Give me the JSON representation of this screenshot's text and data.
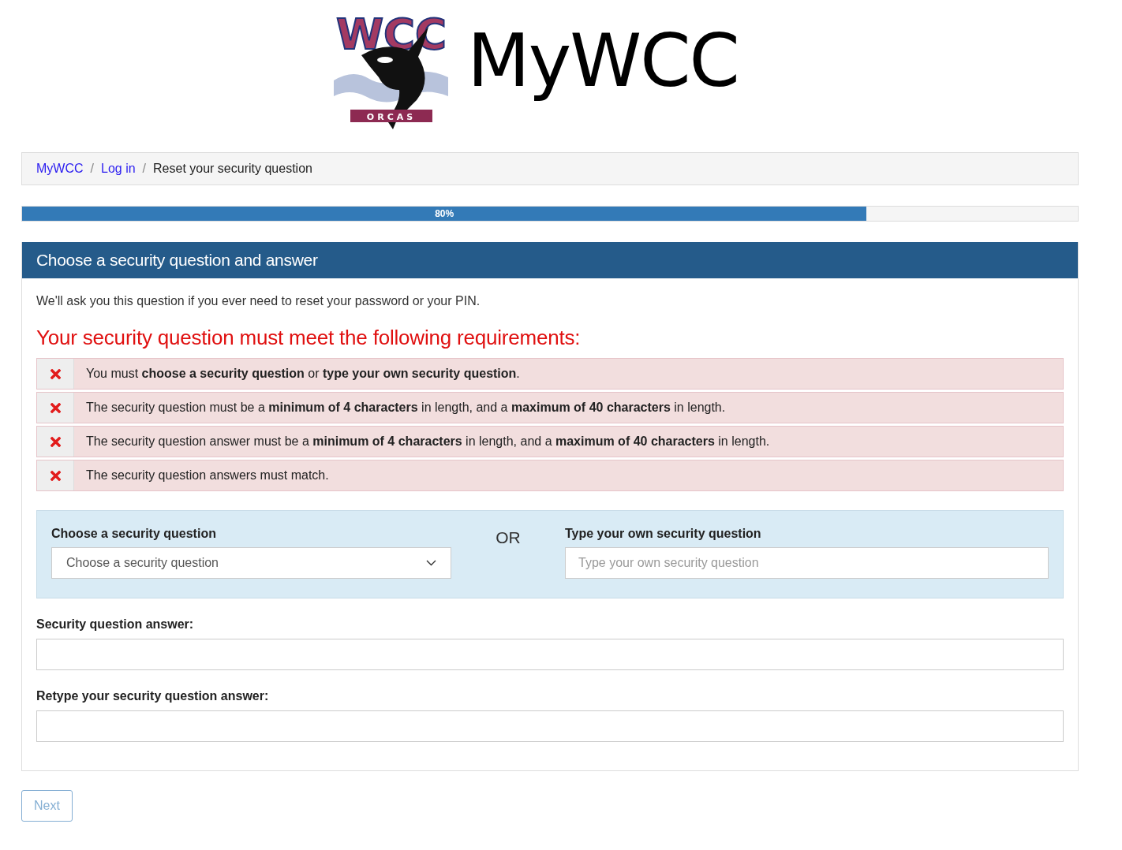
{
  "header": {
    "logo_letters": "WCC",
    "logo_caption": "ORCAS",
    "site_title": "MyWCC"
  },
  "breadcrumb": [
    {
      "label": "MyWCC",
      "current": false
    },
    {
      "separator": "/",
      "label": "Log in",
      "current": false
    },
    {
      "separator": "/",
      "label": "Reset your security question",
      "current": true
    }
  ],
  "progress": {
    "level": 0.8,
    "label": "80%"
  },
  "panel": {
    "title": "Choose a security question and answer",
    "intro": "We'll ask you this question if you ever need to reset your password or your PIN.",
    "requirements_heading": "Your security question must meet the following requirements:",
    "requirements": [
      {
        "text": "You must **choose a security question** or **type your own security question**.",
        "passed": false
      },
      {
        "text": "The security question must be a **minimum of 4 characters** in length, and a **maximum of 40 characters** in length.",
        "passed": false
      },
      {
        "text": "The security question answer must be a **minimum of 4 characters** in length, and a **maximum of 40 characters** in length.",
        "passed": false
      },
      {
        "text": "The security question answers must match.",
        "passed": false
      }
    ],
    "choose": {
      "label": "Choose a security question",
      "placeholder": "Choose a security question"
    },
    "or": "OR",
    "own": {
      "label": "Type your own security question",
      "placeholder": "Type your own security question"
    },
    "answer": {
      "label": "Security question answer:"
    },
    "retype": {
      "label": "Retype your security question answer:"
    }
  },
  "next_button": {
    "label": "Next",
    "disabled": true
  }
}
